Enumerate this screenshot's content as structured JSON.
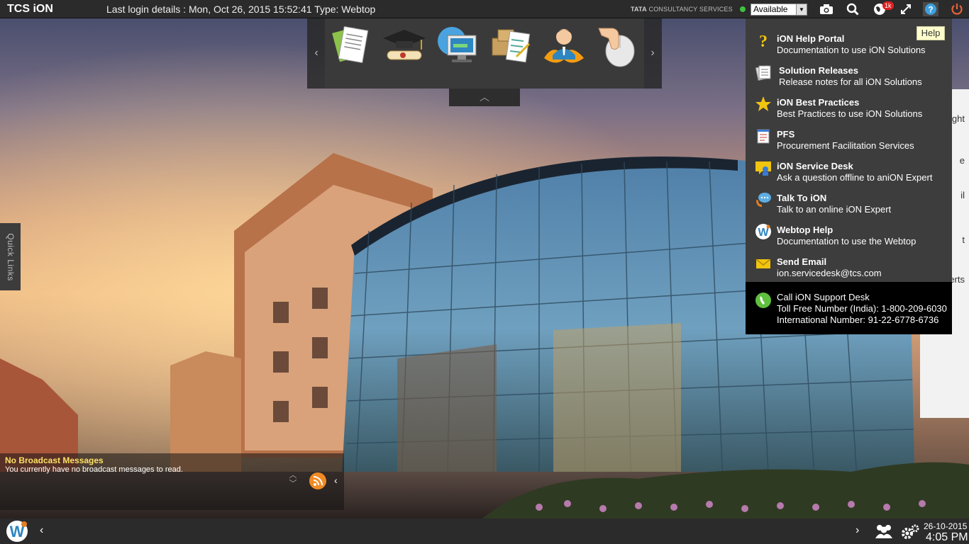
{
  "topbar": {
    "brand": "TCS iON",
    "login_info": "Last login details : Mon, Oct 26, 2015 15:52:41 Type: Webtop",
    "company_bold": "TATA",
    "company_rest": " CONSULTANCY SERVICES",
    "status_value": "Available",
    "notification_count": "1k",
    "icons": [
      "camera-icon",
      "search-icon",
      "notifications-globe-icon",
      "fullscreen-icon",
      "help-icon",
      "power-icon"
    ]
  },
  "tooltip": {
    "text": "Help"
  },
  "carousel": {
    "apps": [
      "documents-app",
      "education-app",
      "monitor-app",
      "inventory-app",
      "users-app",
      "pointer-app"
    ]
  },
  "help_menu": {
    "items": [
      {
        "title": "iON Help Portal",
        "desc": "Documentation to use iON Solutions",
        "icon": "question-icon"
      },
      {
        "title": "Solution Releases",
        "desc": "Release notes for all iON Solutions",
        "icon": "release-notes-icon"
      },
      {
        "title": "iON Best Practices",
        "desc": "Best Practices to use iON Solutions",
        "icon": "star-icon"
      },
      {
        "title": "PFS",
        "desc": "Procurement Facilitation Services",
        "icon": "notepad-icon"
      },
      {
        "title": "iON Service Desk",
        "desc": "Ask a question offline to aniON Expert",
        "icon": "service-desk-icon"
      },
      {
        "title": "Talk To iON",
        "desc": "Talk to an online iON Expert",
        "icon": "chat-icon"
      },
      {
        "title": "Webtop Help",
        "desc": "Documentation to use the Webtop",
        "icon": "webtop-icon"
      },
      {
        "title": "Send Email",
        "desc": "ion.servicedesk@tcs.com",
        "icon": "email-icon"
      }
    ],
    "support": {
      "title": "Call iON Support Desk",
      "toll_free": "Toll Free Number (India): 1-800-209-6030",
      "international": "International Number: 91-22-6778-6736"
    }
  },
  "right_panel": {
    "fragments": [
      "ght",
      "e",
      "il",
      "t",
      "erts"
    ]
  },
  "quick_links": {
    "label": "Quick Links"
  },
  "broadcast": {
    "title": "No Broadcast Messages",
    "text": "You currently have no broadcast messages to read."
  },
  "taskbar": {
    "date": "26-10-2015",
    "time": "4:05 PM"
  },
  "colors": {
    "topbar": "#2b2b2b",
    "menu": "#3d3d3d",
    "broadcast_title": "#ffe066",
    "status_green": "#3fc13f"
  }
}
